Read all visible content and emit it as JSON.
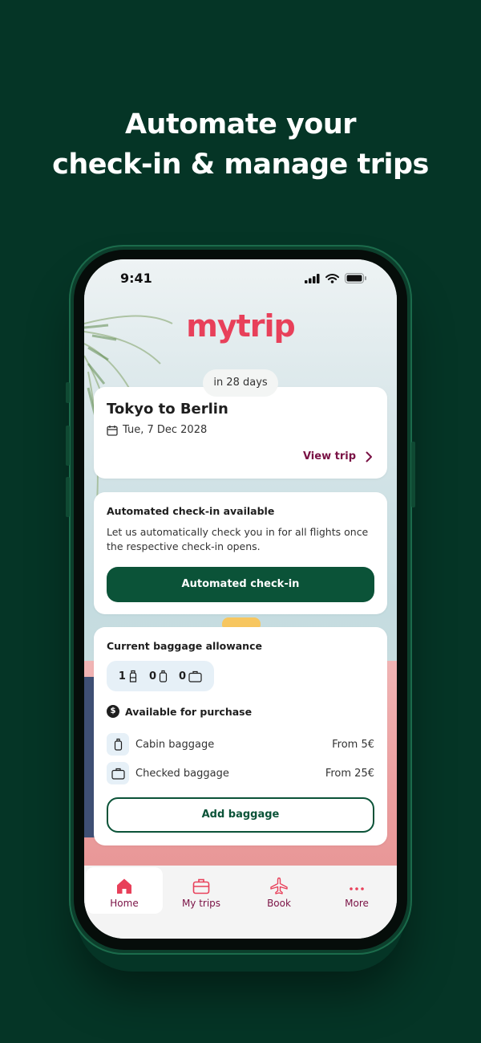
{
  "headline": {
    "line1": "Automate your",
    "line2": "check-in & manage trips"
  },
  "status_bar": {
    "time": "9:41"
  },
  "brand": {
    "logo_text": "mytrip",
    "accent_color": "#e8405a",
    "primary_color": "#0b5338",
    "link_color": "#7a1245"
  },
  "trip": {
    "countdown": "in 28 days",
    "title": "Tokyo to Berlin",
    "date": "Tue, 7 Dec 2028",
    "view_label": "View trip"
  },
  "auto_checkin": {
    "title": "Automated check-in available",
    "description": "Let us automatically check you in for all flights once the respective check-in opens.",
    "button_label": "Automated check-in"
  },
  "baggage": {
    "title": "Current baggage allowance",
    "allowance": [
      {
        "count": "1",
        "icon": "personal-item-icon"
      },
      {
        "count": "0",
        "icon": "cabin-bag-icon"
      },
      {
        "count": "0",
        "icon": "checked-bag-icon"
      }
    ],
    "purchase_title": "Available for purchase",
    "options": [
      {
        "name": "Cabin baggage",
        "price": "From 5€",
        "icon": "cabin-bag-icon"
      },
      {
        "name": "Checked baggage",
        "price": "From 25€",
        "icon": "checked-bag-icon"
      }
    ],
    "add_label": "Add baggage"
  },
  "tabbar": {
    "items": [
      {
        "label": "Home",
        "icon": "home-icon",
        "active": true
      },
      {
        "label": "My trips",
        "icon": "suitcase-icon",
        "active": false
      },
      {
        "label": "Book",
        "icon": "airplane-icon",
        "active": false
      },
      {
        "label": "More",
        "icon": "more-dots-icon",
        "active": false
      }
    ]
  }
}
